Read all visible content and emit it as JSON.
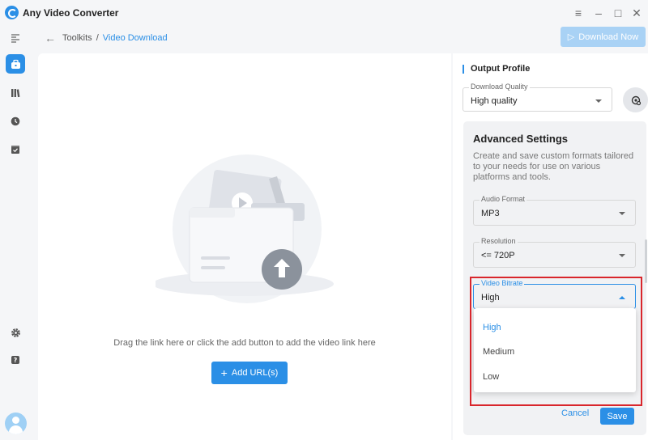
{
  "app": {
    "title": "Any Video Converter"
  },
  "window": {
    "menu_icon": "≡",
    "minimize_icon": "–",
    "maximize_icon": "□",
    "close_icon": "✕"
  },
  "breadcrumb": {
    "back_icon": "←",
    "separator": "/",
    "parent": "Toolkits",
    "current": "Video Download"
  },
  "toolbar": {
    "download_now": "Download Now",
    "download_icon": "▷"
  },
  "main": {
    "drop_hint": "Drag the link here or click the add button to add the video link here",
    "add_url": "Add URL(s)",
    "add_icon": "+"
  },
  "output_profile": {
    "title": "Output Profile",
    "download_quality": {
      "label": "Download Quality",
      "value": "High quality"
    }
  },
  "advanced": {
    "title": "Advanced Settings",
    "description": "Create and save custom formats tailored to your needs for use on various platforms and tools.",
    "audio_format": {
      "label": "Audio Format",
      "value": "MP3"
    },
    "resolution": {
      "label": "Resolution",
      "value": "<= 720P"
    },
    "video_bitrate": {
      "label": "Video Bitrate",
      "value": "High",
      "options": [
        "High",
        "Medium",
        "Low"
      ]
    },
    "cancel": "Cancel",
    "save": "Save"
  },
  "colors": {
    "accent": "#2b8fe6",
    "highlight_box": "#d9262c",
    "disabled_button": "#a9d2f5"
  }
}
